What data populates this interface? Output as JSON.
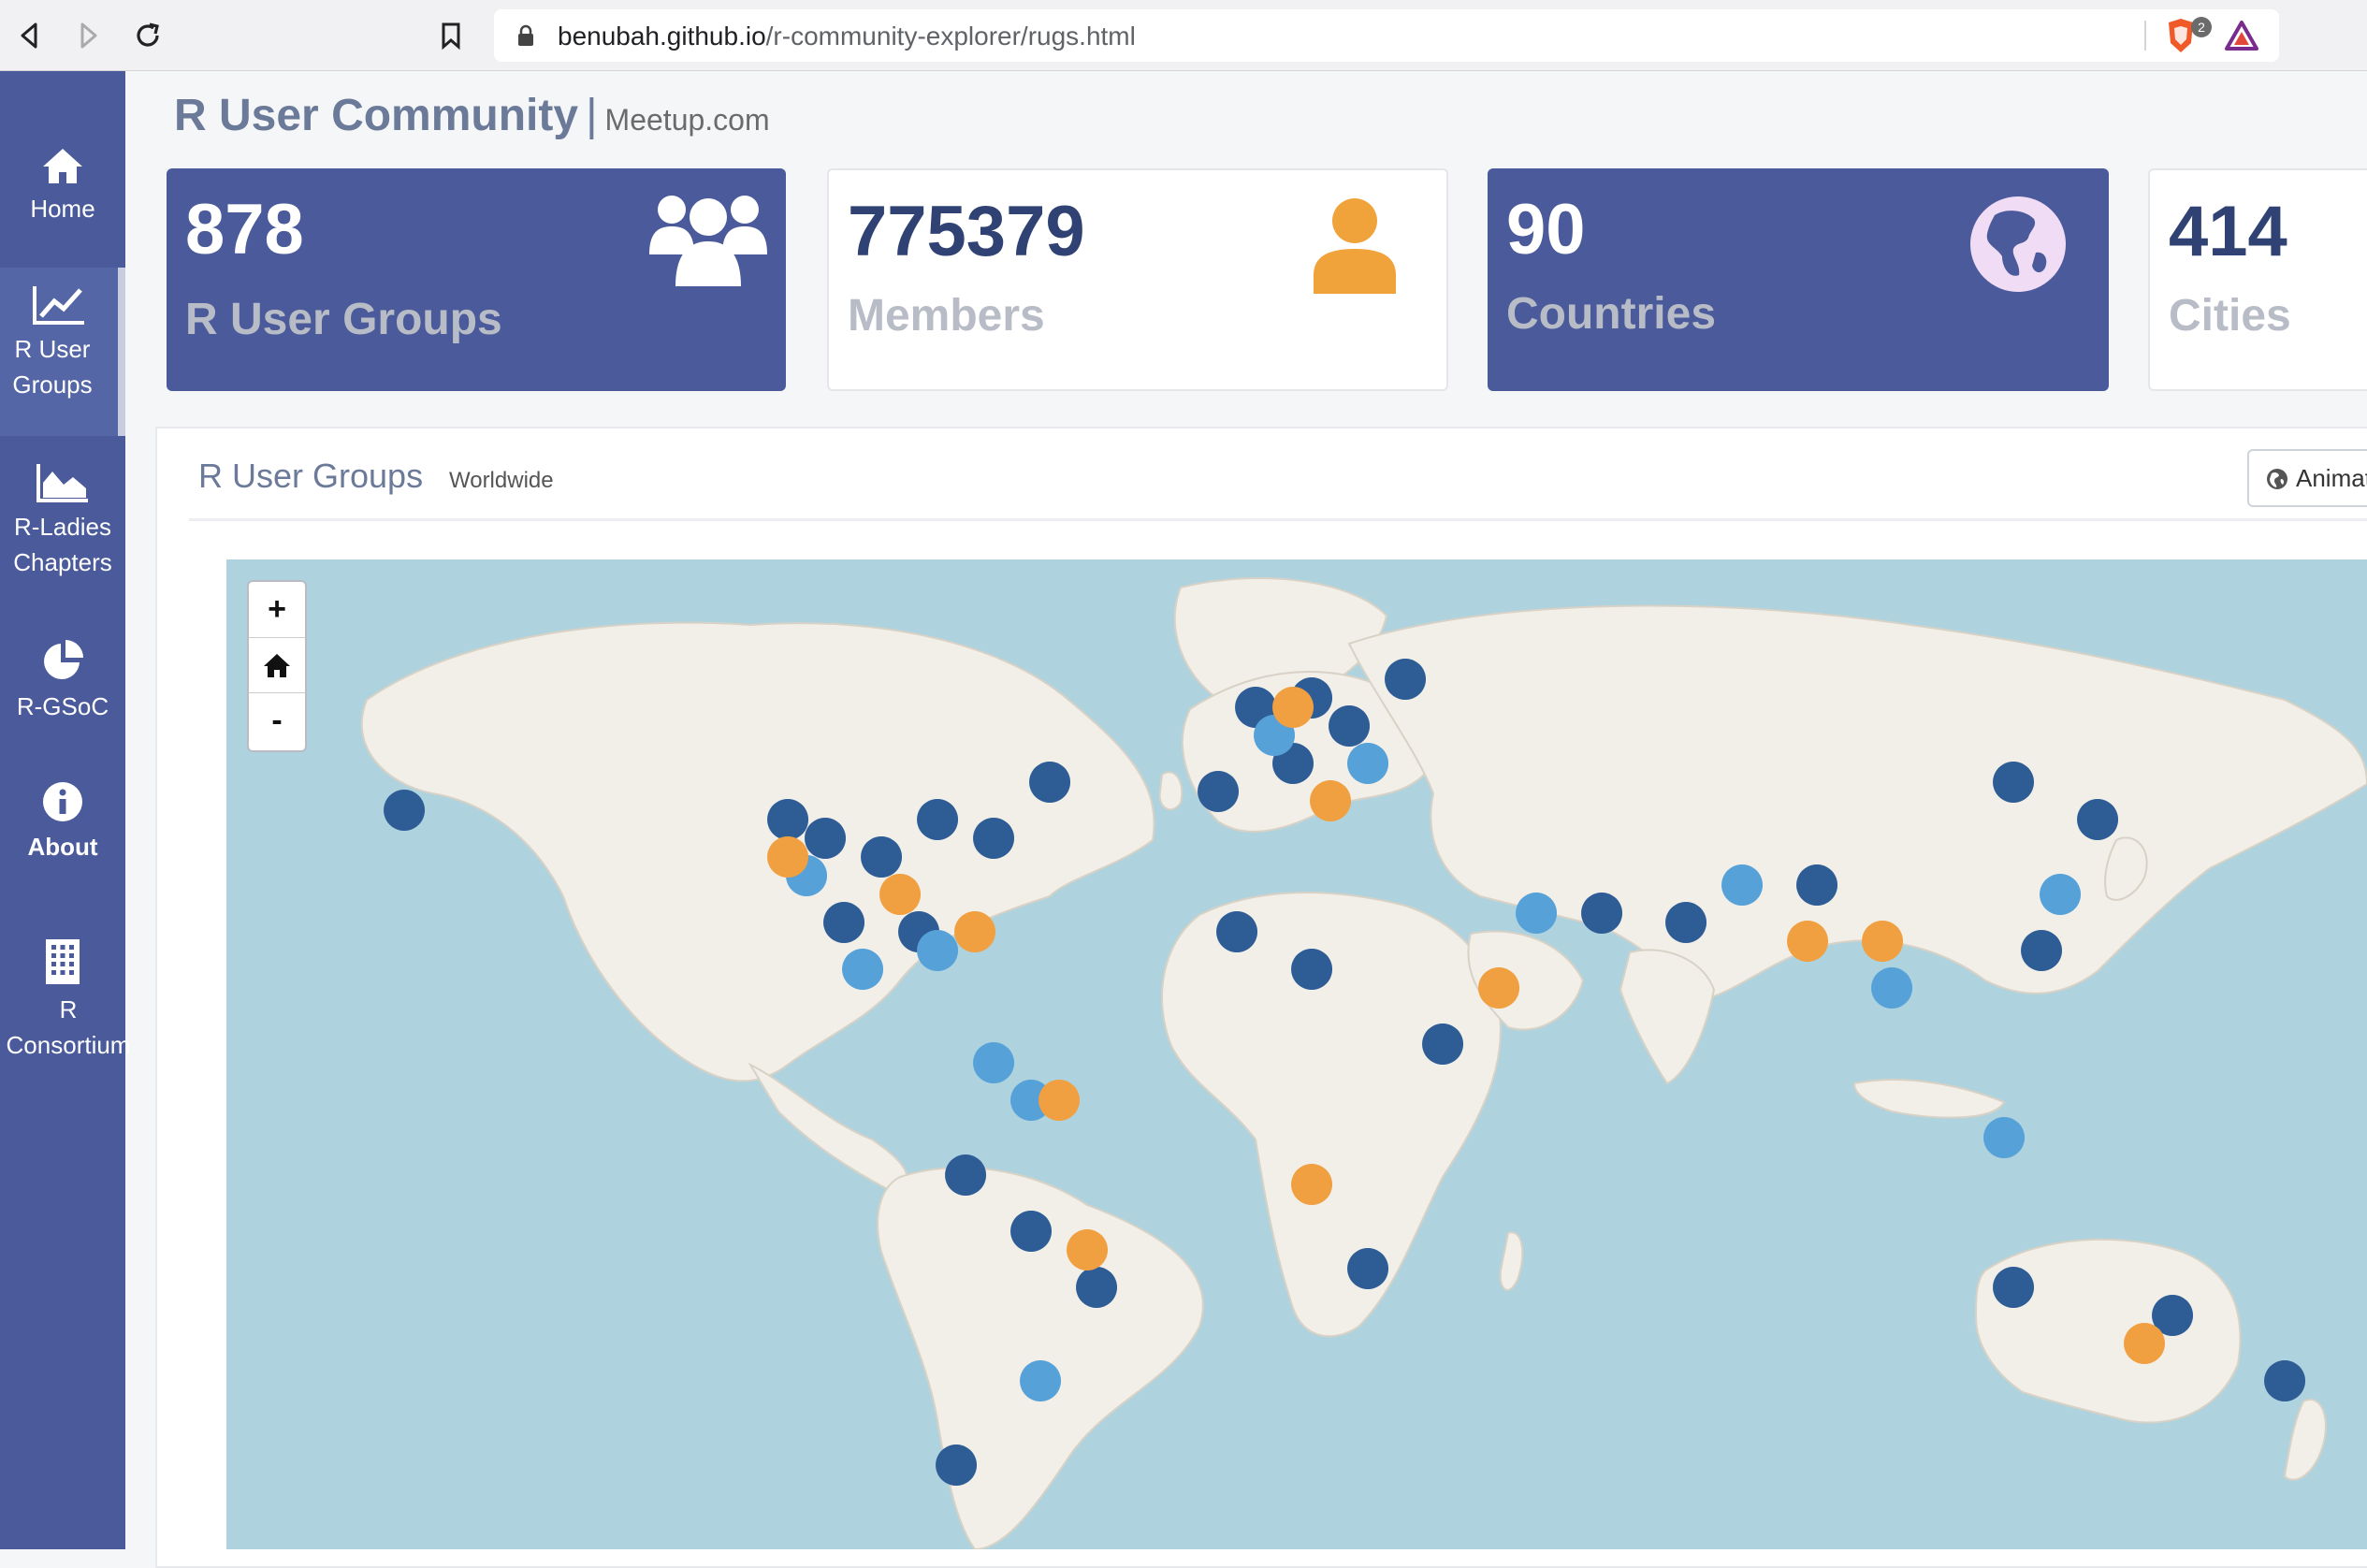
{
  "browser": {
    "url_host": "benubah.github.io",
    "url_path": "/r-community-explorer/rugs.html",
    "shield_count": "2"
  },
  "sidebar": {
    "items": [
      {
        "label": "Home",
        "icon": "home-icon"
      },
      {
        "label": "R User Groups",
        "icon": "line-chart-icon"
      },
      {
        "label": "R-Ladies Chapters",
        "icon": "area-chart-icon"
      },
      {
        "label": "R-GSoC",
        "icon": "pie-chart-icon"
      },
      {
        "label": "About",
        "icon": "info-icon"
      },
      {
        "label": "R Consortium",
        "icon": "building-icon"
      }
    ],
    "active": "R User Groups"
  },
  "header": {
    "title": "R User Community",
    "separator": "|",
    "subtitle": "Meetup.com"
  },
  "stats": [
    {
      "value": "878",
      "label": "R User Groups",
      "icon": "users-icon"
    },
    {
      "value": "775379",
      "label": "Members",
      "icon": "user-icon"
    },
    {
      "value": "90",
      "label": "Countries",
      "icon": "globe-icon"
    },
    {
      "value": "414",
      "label": "Cities",
      "icon": ""
    }
  ],
  "panel": {
    "title": "R User Groups",
    "subtitle": "Worldwide",
    "animate_button": "Animat"
  },
  "map": {
    "zoom_in": "+",
    "zoom_out": "-",
    "home_icon": "home-icon",
    "marker_colors": {
      "dark": "#2e5c95",
      "light": "#56a1d8",
      "orange": "#f0a040"
    }
  }
}
